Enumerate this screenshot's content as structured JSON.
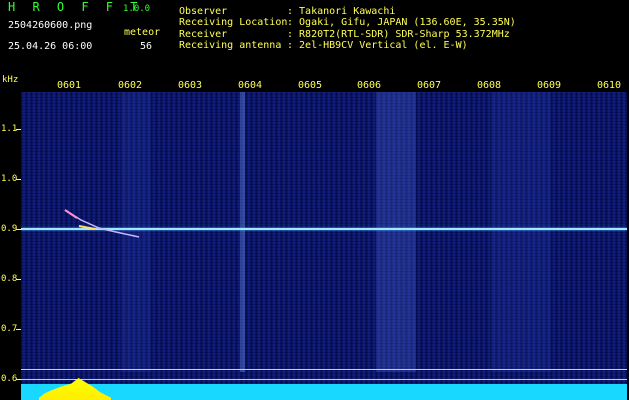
{
  "app": {
    "title": "H R O F F T",
    "version": "1.0.0"
  },
  "file_name": "2504260600.png",
  "date_time": "25.04.26 06:00",
  "meteor": {
    "label": "meteor",
    "count": "56"
  },
  "info": [
    {
      "label": "Observer",
      "value": ": Takanori Kawachi"
    },
    {
      "label": "Receiving Location",
      "value": ": Ogaki, Gifu, JAPAN (136.60E, 35.35N)"
    },
    {
      "label": "Receiver",
      "value": ": R820T2(RTL-SDR) SDR-Sharp 53.372MHz"
    },
    {
      "label": "Receiving antenna",
      "value": ": 2el-HB9CV Vertical (el. E-W)"
    }
  ],
  "x_axis": {
    "ticks": [
      "0601",
      "0602",
      "0603",
      "0604",
      "0605",
      "0606",
      "0607",
      "0608",
      "0609",
      "0610"
    ]
  },
  "y_axis": {
    "unit": "kHz",
    "ticks": [
      "1.1",
      "1.0",
      "0.9",
      "0.8",
      "0.7",
      "0.6"
    ]
  },
  "colors": {
    "label_yellow": "#ffff55",
    "title_green": "#33ff33",
    "background_blue": "#0a1468",
    "carrier": "#9ee8ff",
    "level_cyan": "#18d8ff",
    "level_peak": "#ffff00"
  }
}
